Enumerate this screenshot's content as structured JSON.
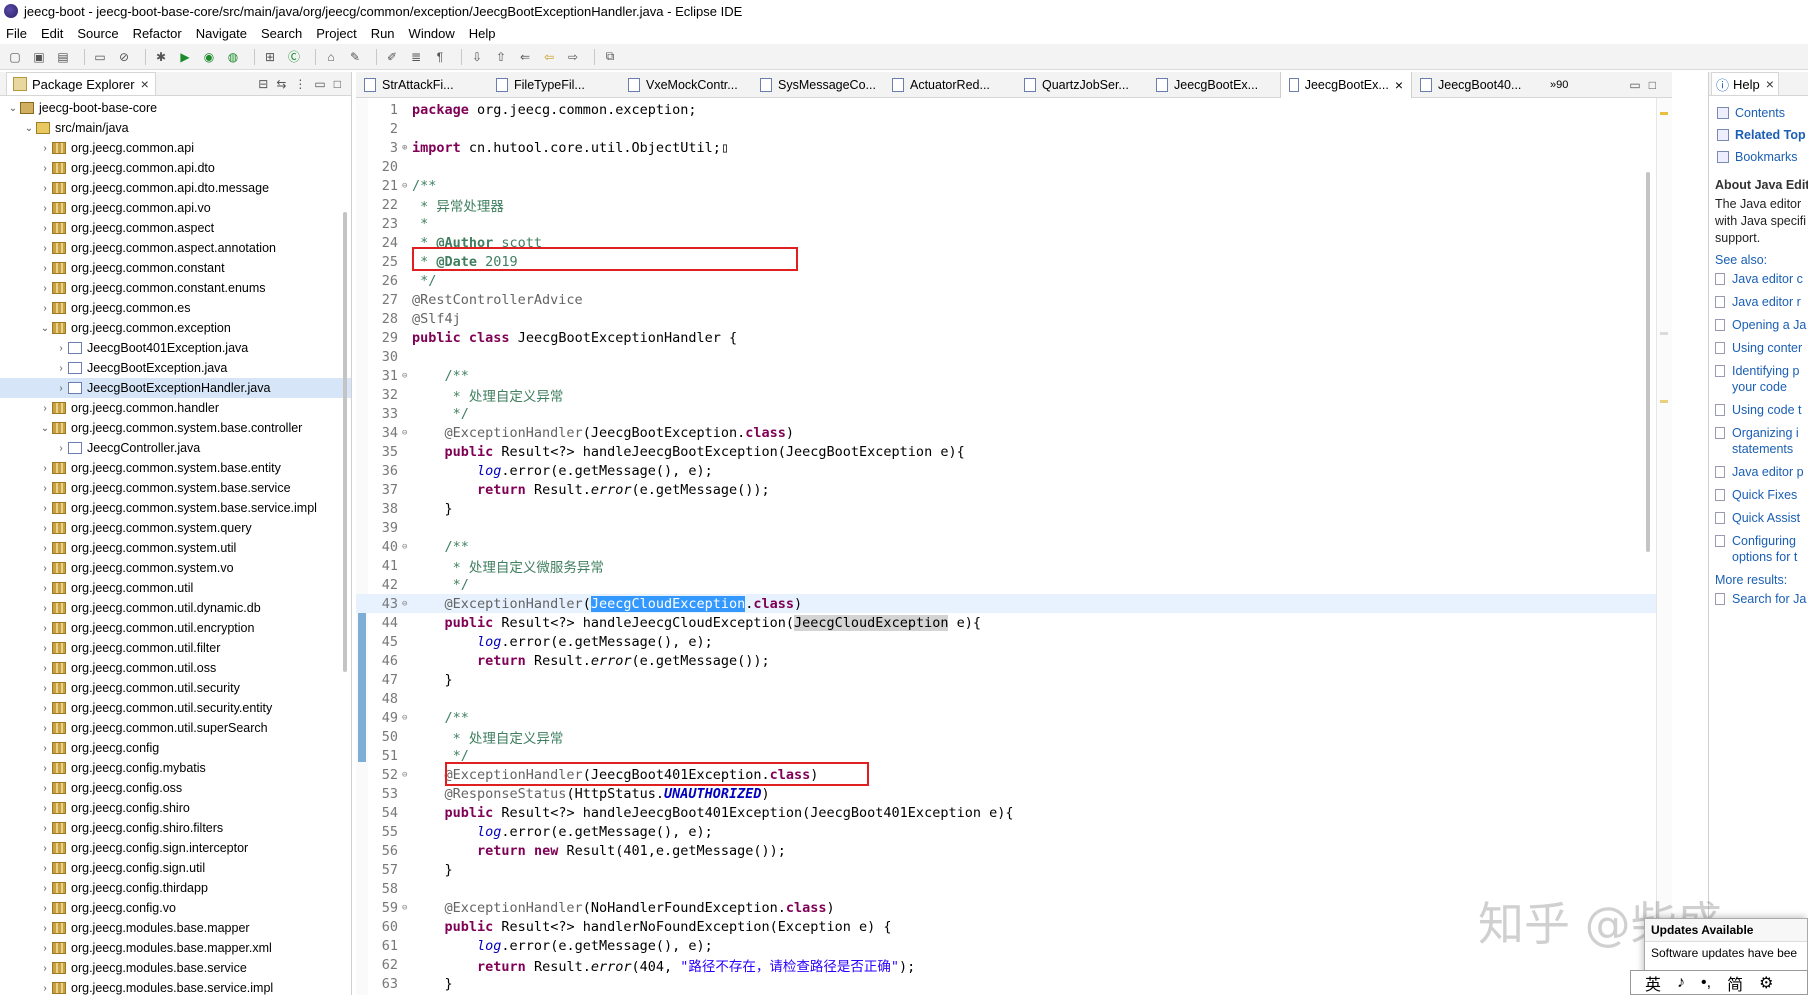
{
  "window": {
    "title": "jeecg-boot - jeecg-boot-base-core/src/main/java/org/jeecg/common/exception/JeecgBootExceptionHandler.java - Eclipse IDE"
  },
  "menu": [
    "File",
    "Edit",
    "Source",
    "Refactor",
    "Navigate",
    "Search",
    "Project",
    "Run",
    "Window",
    "Help"
  ],
  "package_explorer": {
    "tab_label": "Package Explorer",
    "items": [
      {
        "label": "jeecg-boot-base-core",
        "type": "project",
        "indent": 0,
        "expanded": true
      },
      {
        "label": "src/main/java",
        "type": "folder",
        "indent": 1,
        "expanded": true
      },
      {
        "label": "org.jeecg.common.api",
        "type": "pkg",
        "indent": 2
      },
      {
        "label": "org.jeecg.common.api.dto",
        "type": "pkg",
        "indent": 2
      },
      {
        "label": "org.jeecg.common.api.dto.message",
        "type": "pkg",
        "indent": 2
      },
      {
        "label": "org.jeecg.common.api.vo",
        "type": "pkg",
        "indent": 2
      },
      {
        "label": "org.jeecg.common.aspect",
        "type": "pkg",
        "indent": 2
      },
      {
        "label": "org.jeecg.common.aspect.annotation",
        "type": "pkg",
        "indent": 2
      },
      {
        "label": "org.jeecg.common.constant",
        "type": "pkg",
        "indent": 2
      },
      {
        "label": "org.jeecg.common.constant.enums",
        "type": "pkg",
        "indent": 2
      },
      {
        "label": "org.jeecg.common.es",
        "type": "pkg",
        "indent": 2
      },
      {
        "label": "org.jeecg.common.exception",
        "type": "pkg",
        "indent": 2,
        "expanded": true
      },
      {
        "label": "JeecgBoot401Exception.java",
        "type": "java",
        "indent": 3
      },
      {
        "label": "JeecgBootException.java",
        "type": "java",
        "indent": 3
      },
      {
        "label": "JeecgBootExceptionHandler.java",
        "type": "java",
        "indent": 3,
        "selected": true
      },
      {
        "label": "org.jeecg.common.handler",
        "type": "pkg",
        "indent": 2
      },
      {
        "label": "org.jeecg.common.system.base.controller",
        "type": "pkg",
        "indent": 2,
        "expanded": true
      },
      {
        "label": "JeecgController.java",
        "type": "java",
        "indent": 3
      },
      {
        "label": "org.jeecg.common.system.base.entity",
        "type": "pkg",
        "indent": 2
      },
      {
        "label": "org.jeecg.common.system.base.service",
        "type": "pkg",
        "indent": 2
      },
      {
        "label": "org.jeecg.common.system.base.service.impl",
        "type": "pkg",
        "indent": 2
      },
      {
        "label": "org.jeecg.common.system.query",
        "type": "pkg",
        "indent": 2
      },
      {
        "label": "org.jeecg.common.system.util",
        "type": "pkg",
        "indent": 2
      },
      {
        "label": "org.jeecg.common.system.vo",
        "type": "pkg",
        "indent": 2
      },
      {
        "label": "org.jeecg.common.util",
        "type": "pkg",
        "indent": 2
      },
      {
        "label": "org.jeecg.common.util.dynamic.db",
        "type": "pkg",
        "indent": 2
      },
      {
        "label": "org.jeecg.common.util.encryption",
        "type": "pkg",
        "indent": 2
      },
      {
        "label": "org.jeecg.common.util.filter",
        "type": "pkg",
        "indent": 2
      },
      {
        "label": "org.jeecg.common.util.oss",
        "type": "pkg",
        "indent": 2
      },
      {
        "label": "org.jeecg.common.util.security",
        "type": "pkg",
        "indent": 2
      },
      {
        "label": "org.jeecg.common.util.security.entity",
        "type": "pkg",
        "indent": 2
      },
      {
        "label": "org.jeecg.common.util.superSearch",
        "type": "pkg",
        "indent": 2
      },
      {
        "label": "org.jeecg.config",
        "type": "pkg",
        "indent": 2
      },
      {
        "label": "org.jeecg.config.mybatis",
        "type": "pkg",
        "indent": 2
      },
      {
        "label": "org.jeecg.config.oss",
        "type": "pkg",
        "indent": 2
      },
      {
        "label": "org.jeecg.config.shiro",
        "type": "pkg",
        "indent": 2
      },
      {
        "label": "org.jeecg.config.shiro.filters",
        "type": "pkg",
        "indent": 2
      },
      {
        "label": "org.jeecg.config.sign.interceptor",
        "type": "pkg",
        "indent": 2
      },
      {
        "label": "org.jeecg.config.sign.util",
        "type": "pkg",
        "indent": 2
      },
      {
        "label": "org.jeecg.config.thirdapp",
        "type": "pkg",
        "indent": 2
      },
      {
        "label": "org.jeecg.config.vo",
        "type": "pkg",
        "indent": 2
      },
      {
        "label": "org.jeecg.modules.base.mapper",
        "type": "pkg",
        "indent": 2
      },
      {
        "label": "org.jeecg.modules.base.mapper.xml",
        "type": "pkg",
        "indent": 2
      },
      {
        "label": "org.jeecg.modules.base.service",
        "type": "pkg",
        "indent": 2
      },
      {
        "label": "org.jeecg.modules.base.service.impl",
        "type": "pkg",
        "indent": 2
      }
    ]
  },
  "editor": {
    "tabs": [
      {
        "label": "StrAttackFi..."
      },
      {
        "label": "FileTypeFil..."
      },
      {
        "label": "VxeMockContr..."
      },
      {
        "label": "SysMessageCo..."
      },
      {
        "label": "ActuatorRed..."
      },
      {
        "label": "QuartzJobSer..."
      },
      {
        "label": "JeecgBootEx..."
      },
      {
        "label": "JeecgBootEx...",
        "active": true
      },
      {
        "label": "JeecgBoot40..."
      }
    ],
    "overflow_label": "»90",
    "lines": [
      {
        "n": "1",
        "html": "<span class='kw'>package</span> org.jeecg.common.exception;"
      },
      {
        "n": "2",
        "html": ""
      },
      {
        "n": "3",
        "html": "<span class='kw'>import</span> cn.hutool.core.util.ObjectUtil;▯",
        "fold": "⊕"
      },
      {
        "n": "20",
        "html": ""
      },
      {
        "n": "21",
        "html": "<span class='cm'>/**</span>",
        "fold": "⊖"
      },
      {
        "n": "22",
        "html": "<span class='cm'> * 异常处理器</span>"
      },
      {
        "n": "23",
        "html": "<span class='cm'> *</span>"
      },
      {
        "n": "24",
        "html": "<span class='cm'> * <b>@Author</b> scott</span>"
      },
      {
        "n": "25",
        "html": "<span class='cm'> * <b>@Date</b> 2019</span>"
      },
      {
        "n": "26",
        "html": "<span class='cm'> */</span>"
      },
      {
        "n": "27",
        "html": "<span class='ann'>@RestControllerAdvice</span>"
      },
      {
        "n": "28",
        "html": "<span class='ann'>@Slf4j</span>"
      },
      {
        "n": "29",
        "html": "<span class='kw'>public</span> <span class='kw'>class</span> JeecgBootExceptionHandler {"
      },
      {
        "n": "30",
        "html": ""
      },
      {
        "n": "31",
        "html": "    <span class='cm'>/**</span>",
        "fold": "⊖"
      },
      {
        "n": "32",
        "html": "<span class='cm'>     * 处理自定义异常</span>"
      },
      {
        "n": "33",
        "html": "<span class='cm'>     */</span>"
      },
      {
        "n": "34",
        "html": "    <span class='ann'>@ExceptionHandler</span>(JeecgBootException.<span class='kw'>class</span>)",
        "fold": "⊖"
      },
      {
        "n": "35",
        "html": "    <span class='kw'>public</span> Result&lt;?&gt; handleJeecgBootException(JeecgBootException e){"
      },
      {
        "n": "36",
        "html": "        <span class='log'>log</span>.error(e.getMessage(), e);"
      },
      {
        "n": "37",
        "html": "        <span class='kw'>return</span> Result.<span class='it'>error</span>(e.getMessage());"
      },
      {
        "n": "38",
        "html": "    }"
      },
      {
        "n": "39",
        "html": ""
      },
      {
        "n": "40",
        "html": "    <span class='cm'>/**</span>",
        "fold": "⊖"
      },
      {
        "n": "41",
        "html": "<span class='cm'>     * 处理自定义微服务异常</span>"
      },
      {
        "n": "42",
        "html": "<span class='cm'>     */</span>"
      },
      {
        "n": "43",
        "html": "    <span class='ann'>@ExceptionHandler</span>(<span class='sel'>JeecgCloudException</span>.<span class='kw'>class</span>)",
        "fold": "⊖",
        "hl": true
      },
      {
        "n": "44",
        "html": "    <span class='kw'>public</span> Result&lt;?&gt; handleJeecgCloudException(<span class='occ'>JeecgCloudException</span> e){"
      },
      {
        "n": "45",
        "html": "        <span class='log'>log</span>.error(e.getMessage(), e);"
      },
      {
        "n": "46",
        "html": "        <span class='kw'>return</span> Result.<span class='it'>error</span>(e.getMessage());"
      },
      {
        "n": "47",
        "html": "    }"
      },
      {
        "n": "48",
        "html": ""
      },
      {
        "n": "49",
        "html": "    <span class='cm'>/**</span>",
        "fold": "⊖"
      },
      {
        "n": "50",
        "html": "<span class='cm'>     * 处理自定义异常</span>"
      },
      {
        "n": "51",
        "html": "<span class='cm'>     */</span>"
      },
      {
        "n": "52",
        "html": "    <span class='ann'>@ExceptionHandler</span>(JeecgBoot401Exception.<span class='kw'>class</span>)",
        "fold": "⊖"
      },
      {
        "n": "53",
        "html": "    <span class='ann'>@ResponseStatus</span>(HttpStatus.<span class='const'>UNAUTHORIZED</span>)"
      },
      {
        "n": "54",
        "html": "    <span class='kw'>public</span> Result&lt;?&gt; handleJeecgBoot401Exception(JeecgBoot401Exception e){"
      },
      {
        "n": "55",
        "html": "        <span class='log'>log</span>.error(e.getMessage(), e);"
      },
      {
        "n": "56",
        "html": "        <span class='kw'>return</span> <span class='kw'>new</span> Result(401,e.getMessage());"
      },
      {
        "n": "57",
        "html": "    }"
      },
      {
        "n": "58",
        "html": ""
      },
      {
        "n": "59",
        "html": "    <span class='ann'>@ExceptionHandler</span>(NoHandlerFoundException.<span class='kw'>class</span>)",
        "fold": "⊖"
      },
      {
        "n": "60",
        "html": "    <span class='kw'>public</span> Result&lt;?&gt; handlerNoFoundException(Exception e) {"
      },
      {
        "n": "61",
        "html": "        <span class='log'>log</span>.error(e.getMessage(), e);"
      },
      {
        "n": "62",
        "html": "        <span class='kw'>return</span> Result.<span class='it'>error</span>(404, <span class='str'>\"路径不存在，请检查路径是否正确\"</span>);"
      },
      {
        "n": "63",
        "html": "    }"
      }
    ]
  },
  "help": {
    "tab_label": "Help",
    "links": [
      {
        "label": "Contents"
      },
      {
        "label": "Related Top",
        "bold": true
      },
      {
        "label": "Bookmarks"
      }
    ],
    "about_head": "About Java Edit",
    "about_lines": [
      "The Java editor",
      "with Java specifi",
      "support."
    ],
    "see_also": "See also:",
    "items": [
      [
        "Java editor c"
      ],
      [
        "Java editor r"
      ],
      [
        "Opening a Ja"
      ],
      [
        "Using conter"
      ],
      [
        "Identifying p",
        "your code"
      ],
      [
        "Using code t"
      ],
      [
        "Organizing i",
        "statements"
      ],
      [
        "Java editor p"
      ],
      [
        "Quick Fixes"
      ],
      [
        "Quick Assist"
      ],
      [
        "Configuring",
        "options for t"
      ]
    ],
    "more_results": "More results:",
    "search_for": "Search for Ja"
  },
  "watermark": "知乎 @柴盛",
  "notification": {
    "title": "Updates Available",
    "body": "Software updates have bee"
  },
  "ime": [
    "英",
    "♪",
    "•,",
    "简",
    "⚙"
  ]
}
